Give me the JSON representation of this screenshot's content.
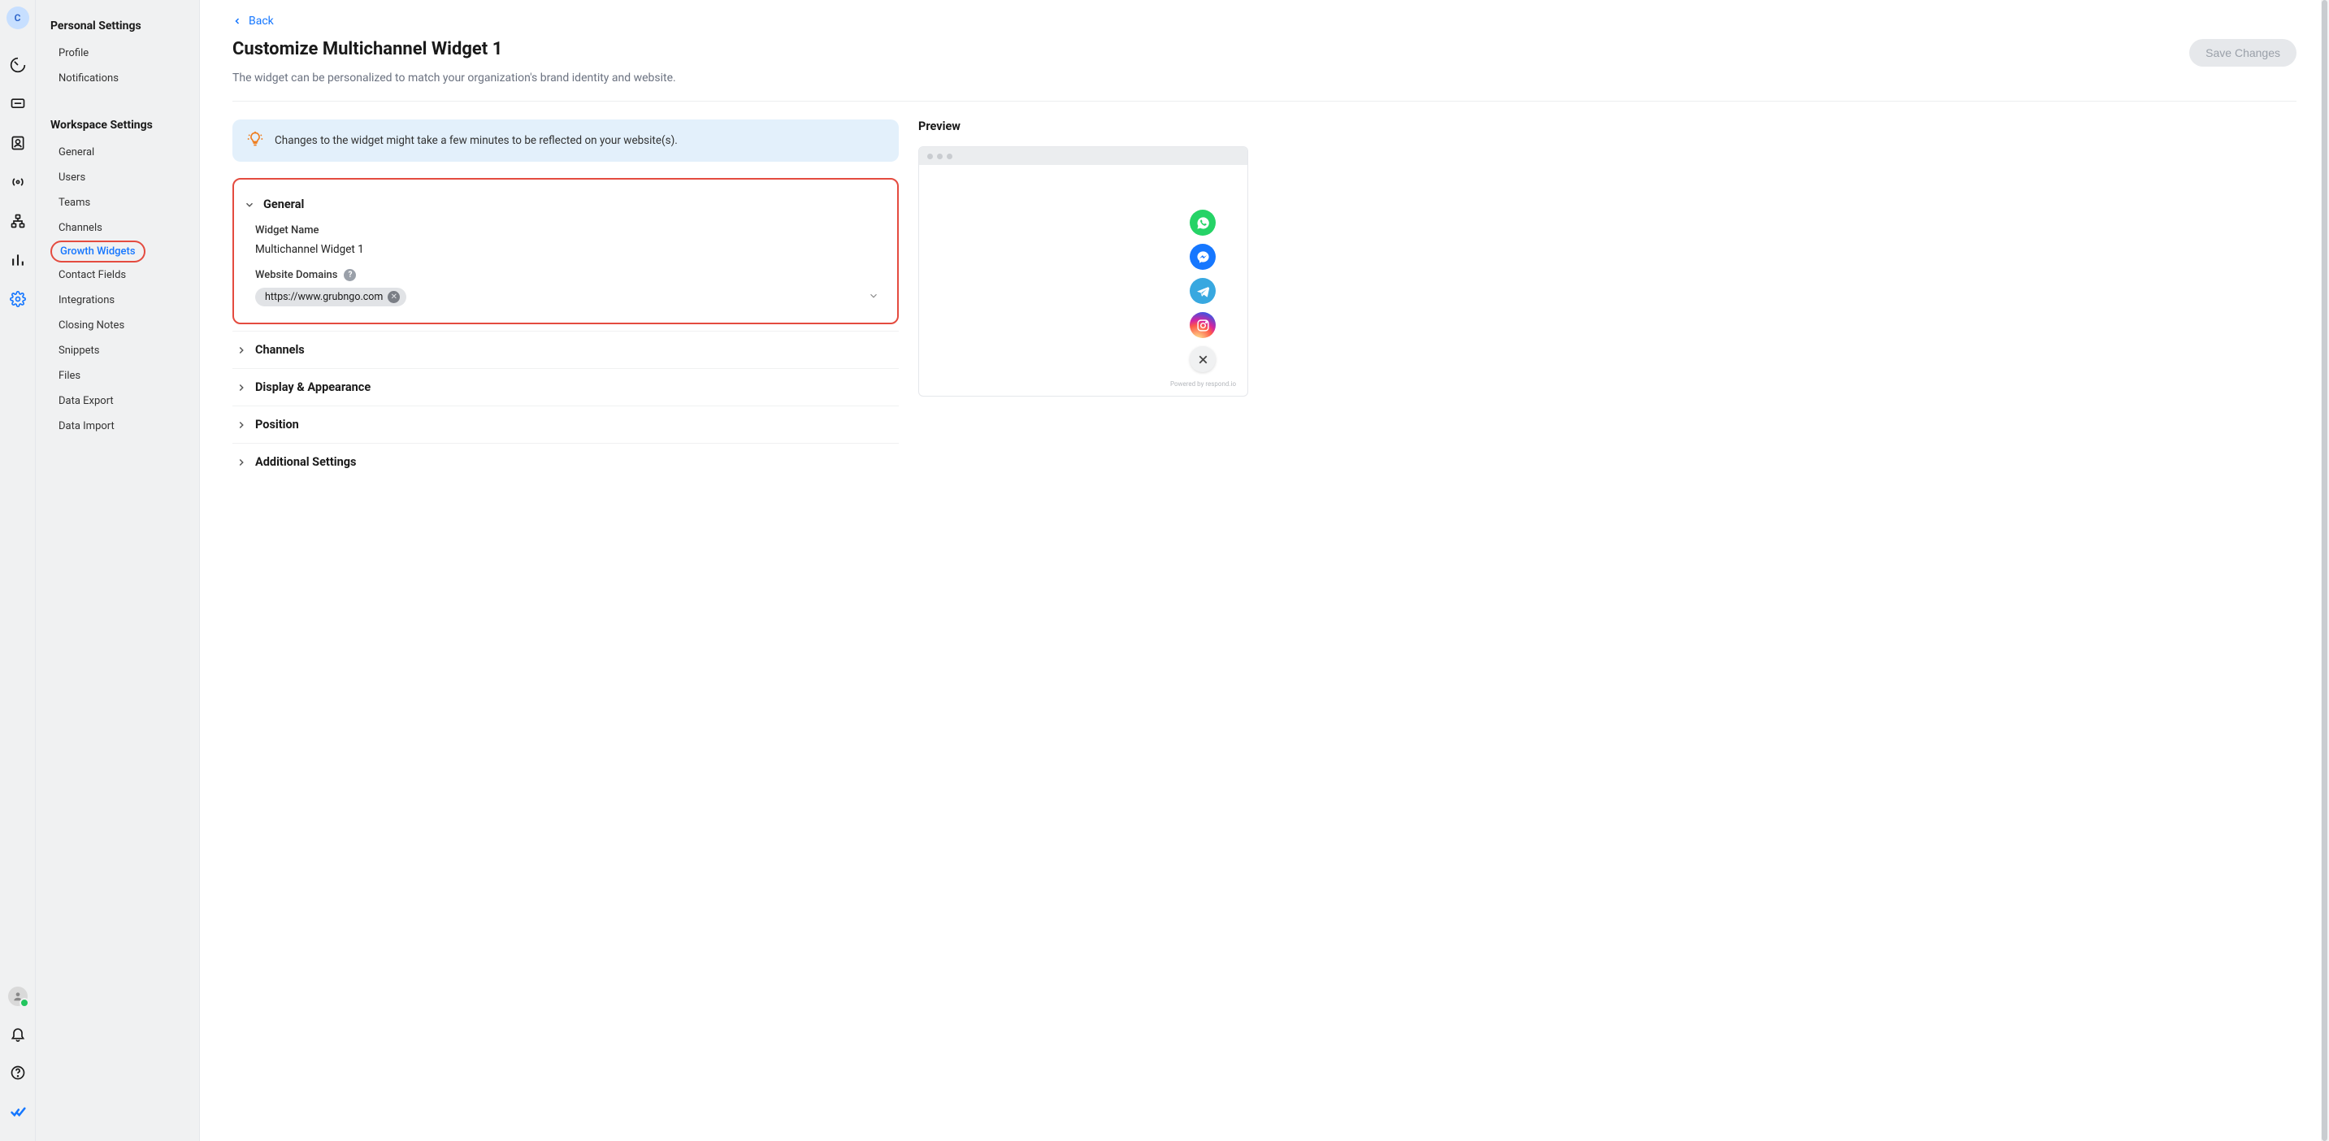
{
  "rail": {
    "avatar_letter": "C"
  },
  "sidebar": {
    "personal_heading": "Personal Settings",
    "personal_items": [
      "Profile",
      "Notifications"
    ],
    "workspace_heading": "Workspace Settings",
    "workspace_items": [
      "General",
      "Users",
      "Teams",
      "Channels",
      "Growth Widgets",
      "Contact Fields",
      "Integrations",
      "Closing Notes",
      "Snippets",
      "Files",
      "Data Export",
      "Data Import"
    ],
    "active_workspace_item": "Growth Widgets"
  },
  "main": {
    "back_label": "Back",
    "title": "Customize Multichannel Widget 1",
    "description": "The widget can be personalized to match your organization's brand identity and website.",
    "save_label": "Save Changes",
    "banner_text": "Changes to the widget might take a few minutes to be reflected on your website(s).",
    "sections": {
      "general": {
        "title": "General",
        "widget_name_label": "Widget Name",
        "widget_name_value": "Multichannel Widget 1",
        "domains_label": "Website Domains",
        "domains": [
          "https://www.grubngo.com"
        ]
      },
      "channels": "Channels",
      "display": "Display & Appearance",
      "position": "Position",
      "additional": "Additional Settings"
    }
  },
  "preview": {
    "heading": "Preview",
    "powered": "Powered by respond.io"
  }
}
